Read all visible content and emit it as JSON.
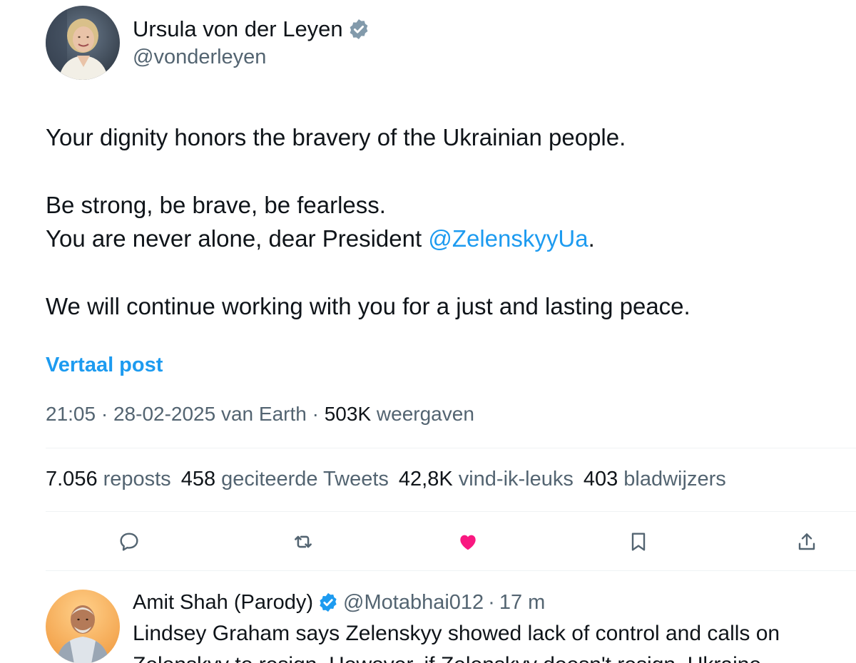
{
  "author": {
    "name": "Ursula von der Leyen",
    "handle": "@vonderleyen",
    "avatar": "profile-photo"
  },
  "tweet": {
    "line1": "Your dignity honors the bravery of the Ukrainian people.",
    "line2": "Be strong, be brave, be fearless.",
    "line3_prefix": "You are never alone, dear President ",
    "line3_mention": "@ZelenskyyUa",
    "line3_suffix": ".",
    "line4": "We will continue working with you for a just and lasting peace.",
    "translate_label": "Vertaal post"
  },
  "meta": {
    "time": "21:05",
    "sep1": " · ",
    "date": "28-02-2025",
    "source": " van Earth",
    "sep2": " · ",
    "views": "503K",
    "views_label": " weergaven"
  },
  "stats": [
    {
      "num": "7.056",
      "label": "reposts"
    },
    {
      "num": "458",
      "label": "geciteerde Tweets"
    },
    {
      "num": "42,8K",
      "label": "vind-ik-leuks"
    },
    {
      "num": "403",
      "label": "bladwijzers"
    }
  ],
  "actions": {
    "reply": "reply-icon",
    "repost": "repost-icon",
    "like": "heart-icon",
    "bookmark": "bookmark-icon",
    "share": "share-icon"
  },
  "reply": {
    "name": "Amit Shah (Parody)",
    "handle": "@Motabhai012",
    "sep": "·",
    "time": "17 m",
    "text": "Lindsey Graham says Zelenskyy showed lack of control and calls on",
    "text_cut": "Zelenskyy to resign. However, if Zelenskyy doesn't resign, Ukraine"
  },
  "colors": {
    "accent": "#1d9bf0",
    "like": "#f91880",
    "text": "#0f1419",
    "muted": "#536471"
  }
}
